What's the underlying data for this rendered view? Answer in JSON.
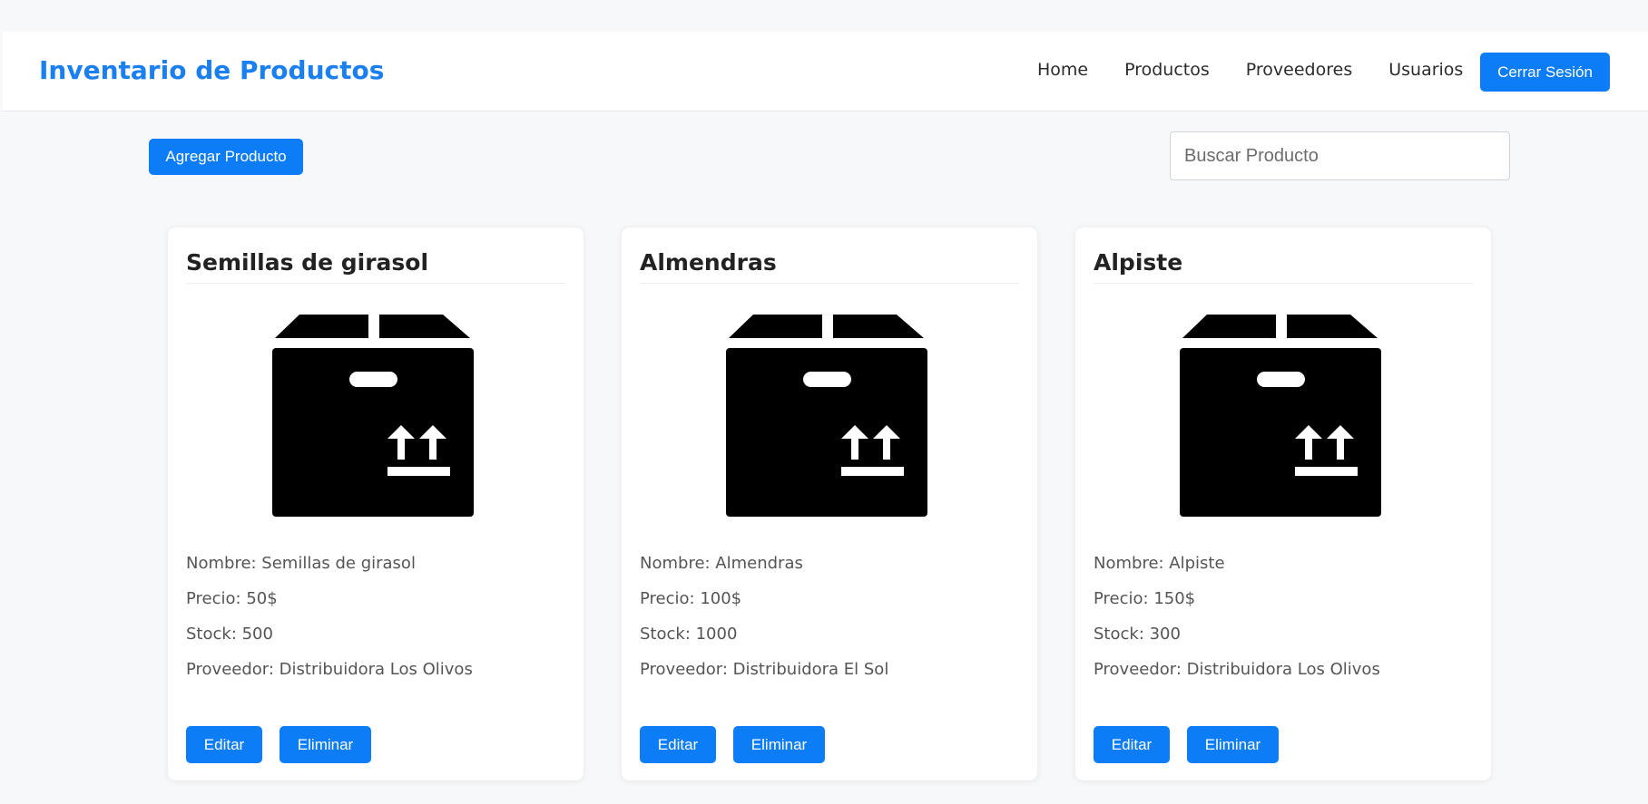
{
  "header": {
    "title": "Inventario de Productos",
    "nav": [
      "Home",
      "Productos",
      "Proveedores",
      "Usuarios"
    ],
    "logout_label": "Cerrar Sesión"
  },
  "toolbar": {
    "add_label": "Agregar Producto",
    "search_placeholder": "Buscar Producto"
  },
  "products": [
    {
      "title": "Semillas de girasol",
      "nombre": "Nombre: Semillas de girasol",
      "precio": "Precio: 50$",
      "stock": "Stock: 500",
      "proveedor": "Proveedor: Distribuidora Los Olivos",
      "icon": "box-icon"
    },
    {
      "title": "Almendras",
      "nombre": "Nombre: Almendras",
      "precio": "Precio: 100$",
      "stock": "Stock: 1000",
      "proveedor": "Proveedor: Distribuidora El Sol",
      "icon": "box-icon"
    },
    {
      "title": "Alpiste",
      "nombre": "Nombre: Alpiste",
      "precio": "Precio: 150$",
      "stock": "Stock: 300",
      "proveedor": "Proveedor: Distribuidora Los Olivos",
      "icon": "box-icon"
    }
  ],
  "card_actions": {
    "edit_label": "Editar",
    "delete_label": "Eliminar"
  },
  "colors": {
    "accent": "#0d7df7",
    "brand": "#1a7ff0",
    "background": "#f7f8fa"
  }
}
